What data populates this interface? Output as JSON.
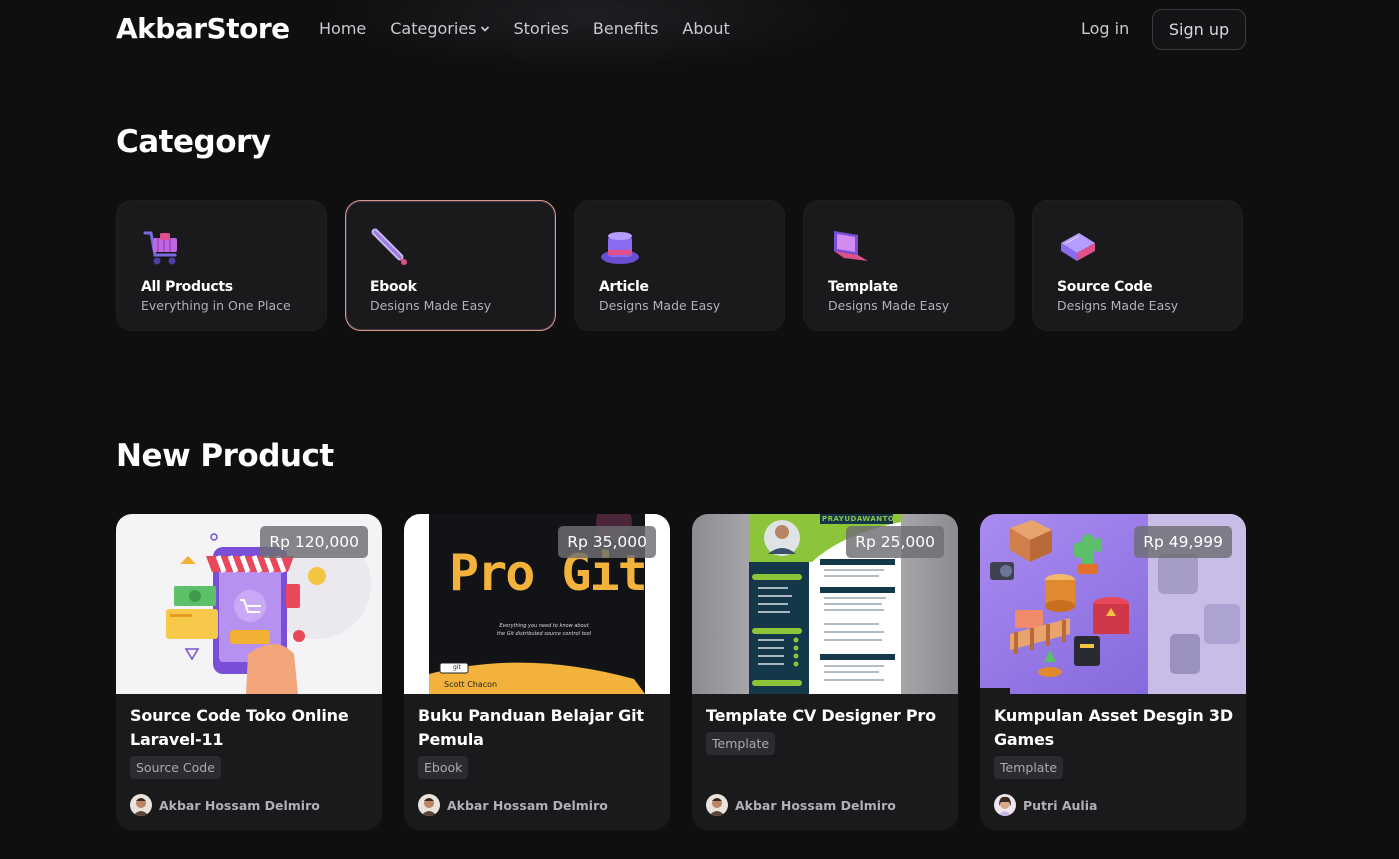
{
  "nav": {
    "brand": "AkbarStore",
    "links": [
      "Home",
      "Categories",
      "Stories",
      "Benefits",
      "About"
    ],
    "login": "Log in",
    "signup": "Sign up"
  },
  "category": {
    "heading": "Category",
    "items": [
      {
        "title": "All Products",
        "subtitle": "Everything in One Place",
        "icon": "shopping-cart-icon"
      },
      {
        "title": "Ebook",
        "subtitle": "Designs Made Easy",
        "icon": "pen-icon",
        "selected": true
      },
      {
        "title": "Article",
        "subtitle": "Designs Made Easy",
        "icon": "hat-icon"
      },
      {
        "title": "Template",
        "subtitle": "Designs Made Easy",
        "icon": "laptop-icon"
      },
      {
        "title": "Source Code",
        "subtitle": "Designs Made Easy",
        "icon": "book-icon"
      }
    ]
  },
  "products": {
    "heading": "New Product",
    "items": [
      {
        "price": "Rp 120,000",
        "title": "Source Code Toko Online Laravel-11",
        "tag": "Source Code",
        "author": "Akbar Hossam Delmiro"
      },
      {
        "price": "Rp 35,000",
        "title": "Buku Panduan Belajar Git Pemula",
        "tag": "Ebook",
        "author": "Akbar Hossam Delmiro",
        "cover": {
          "title": "Pro Git",
          "tagline_1": "Everything you need to know about",
          "tagline_2": "the Git distributed source control tool",
          "badge": "git",
          "author": "Scott Chacon"
        }
      },
      {
        "price": "Rp 25,000",
        "title": "Template CV Designer Pro",
        "tag": "Template",
        "author": "Akbar Hossam Delmiro",
        "cover": {
          "name": "PRAYUDAWANTO"
        }
      },
      {
        "price": "Rp 49,999",
        "title": "Kumpulan Asset Desgin 3D Games",
        "tag": "Template",
        "author": "Putri Aulia"
      }
    ]
  },
  "colors": {
    "background": "#0f0f10",
    "card": "#1a1a1c",
    "active_border": "#d69a86",
    "tag_bg": "#2c2c30"
  }
}
